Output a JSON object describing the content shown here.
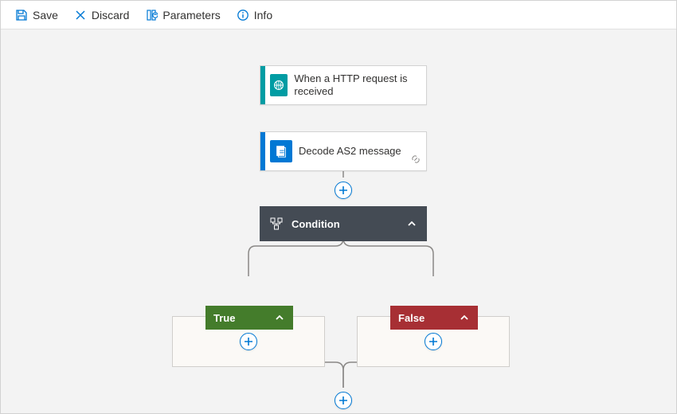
{
  "toolbar": {
    "save": "Save",
    "discard": "Discard",
    "parameters": "Parameters",
    "info": "Info"
  },
  "flow": {
    "trigger": {
      "label": "When a HTTP request is received"
    },
    "decode": {
      "label": "Decode AS2 message"
    },
    "condition": {
      "label": "Condition"
    },
    "branches": {
      "true": {
        "label": "True"
      },
      "false": {
        "label": "False"
      }
    }
  },
  "colors": {
    "accent": "#0078d4",
    "trigger": "#009ca3",
    "conditionBg": "#444b54",
    "trueBg": "#447c2b",
    "falseBg": "#a72f34"
  }
}
